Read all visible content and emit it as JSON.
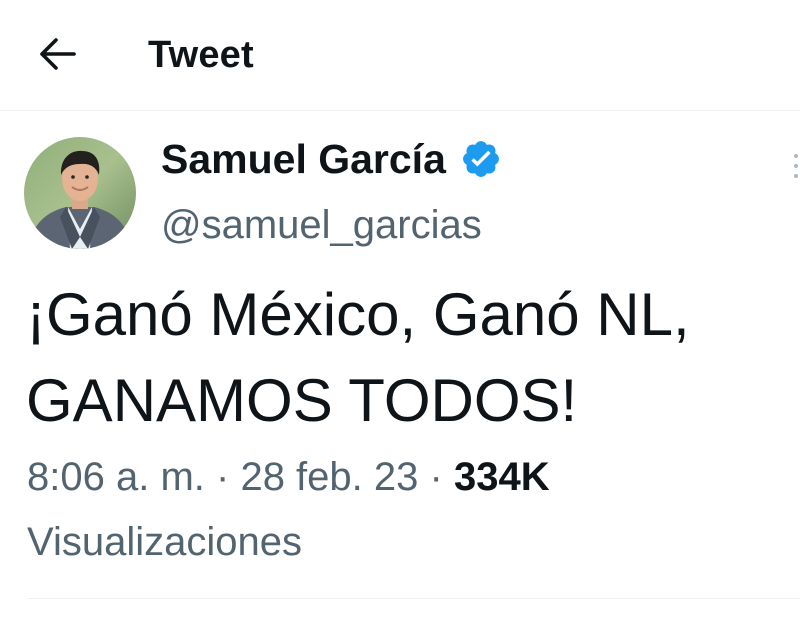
{
  "header": {
    "title": "Tweet",
    "back_icon": "arrow-left-icon"
  },
  "author": {
    "display_name": "Samuel García",
    "handle": "@samuel_garcias",
    "verified": true,
    "verified_color": "#1d9bf0"
  },
  "tweet": {
    "lines": [
      "¡Ganó México, Ganó NL,",
      "GANAMOS TODOS!"
    ]
  },
  "meta": {
    "time": "8:06 a. m.",
    "separator": "·",
    "date": "28 feb. 23",
    "views_count": "334K",
    "views_label": "Visualizaciones"
  },
  "colors": {
    "text_primary": "#0f1419",
    "text_secondary": "#536471",
    "accent": "#1d9bf0",
    "divider": "#eff3f4"
  }
}
